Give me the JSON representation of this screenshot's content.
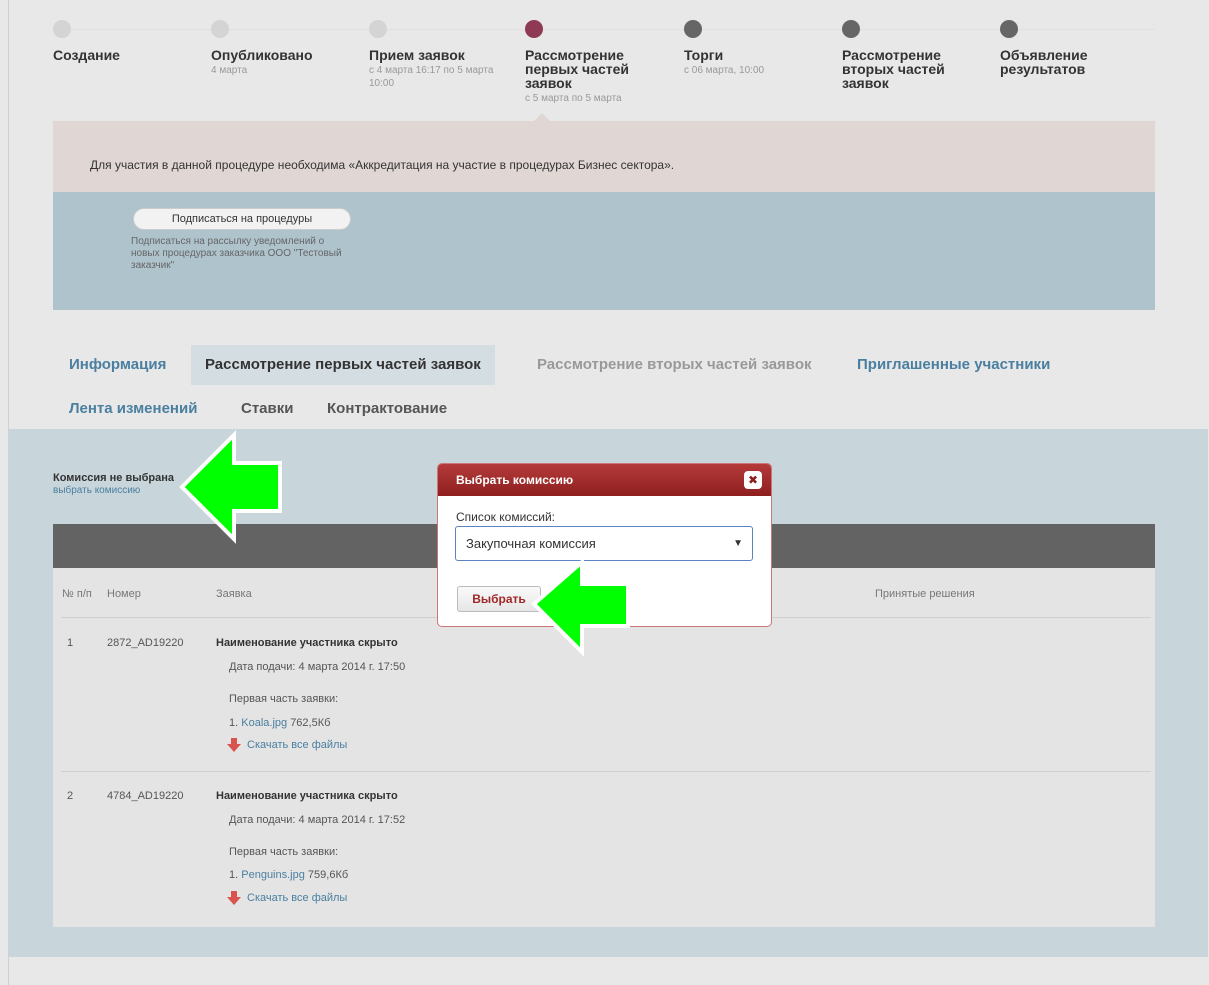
{
  "stepper": {
    "steps": [
      {
        "title": "Создание",
        "sub": ""
      },
      {
        "title": "Опубликовано",
        "sub": "4 марта"
      },
      {
        "title": "Прием заявок",
        "sub": "с 4 марта 16:17 по 5 марта 10:00"
      },
      {
        "title": "Рассмотрение первых частей заявок",
        "sub": "с 5 марта по 5 марта"
      },
      {
        "title": "Торги",
        "sub": "с 06 марта, 10:00"
      },
      {
        "title": "Рассмотрение вторых частей заявок",
        "sub": ""
      },
      {
        "title": "Объявление результатов",
        "sub": ""
      }
    ]
  },
  "alert": {
    "text": "Для участия в данной процедуре необходима «Аккредитация на участие в процедурах Бизнес сектора»."
  },
  "subscribe": {
    "button_label": "Подписаться на процедуры",
    "description": "Подписаться на рассылку уведомлений о новых процедурах заказчика ООО \"Тестовый заказчик\""
  },
  "tabs": [
    "Информация",
    "Рассмотрение первых частей заявок",
    "Рассмотрение вторых частей заявок",
    "Приглашенные участники",
    "Лента изменений",
    "Ставки",
    "Контрактование"
  ],
  "commission": {
    "status": "Комиссия не выбрана",
    "link": "выбрать комиссию"
  },
  "table": {
    "headers": {
      "num": "№ п/п",
      "code": "Номер",
      "app": "Заявка",
      "decisions": "Принятые решения"
    },
    "rows": [
      {
        "num": "1",
        "code": "2872_AD19220",
        "name": "Наименование участника скрыто",
        "date": "Дата подачи: 4 марта 2014 г. 17:50",
        "part": "Первая часть заявки:",
        "file_index": "1.",
        "file_name": "Koala.jpg",
        "file_size": "762,5Кб",
        "download": "Скачать все файлы"
      },
      {
        "num": "2",
        "code": "4784_AD19220",
        "name": "Наименование участника скрыто",
        "date": "Дата подачи: 4 марта 2014 г. 17:52",
        "part": "Первая часть заявки:",
        "file_index": "1.",
        "file_name": "Penguins.jpg",
        "file_size": "759,6Кб",
        "download": "Скачать все файлы"
      }
    ]
  },
  "modal": {
    "title": "Выбрать комиссию",
    "close": "✖",
    "label": "Список комиссий:",
    "selected": "Закупочная комиссия",
    "button": "Выбрать"
  },
  "colors": {
    "accent": "#8e3a55",
    "modal_header": "#a02828",
    "link": "#4a7fa0",
    "arrow": "#00ff00"
  }
}
